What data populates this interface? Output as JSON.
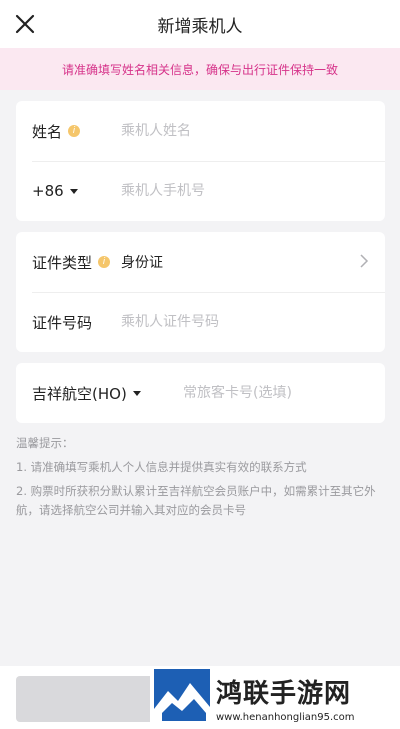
{
  "header": {
    "title": "新增乘机人",
    "close_icon": "close-icon"
  },
  "notice": {
    "text": "请准确填写姓名相关信息，确保与出行证件保持一致"
  },
  "name_card": {
    "name_label": "姓名",
    "name_placeholder": "乘机人姓名",
    "phone_prefix": "+86",
    "phone_placeholder": "乘机人手机号"
  },
  "id_card": {
    "type_label": "证件类型",
    "type_value": "身份证",
    "number_label": "证件号码",
    "number_placeholder": "乘机人证件号码"
  },
  "airline_card": {
    "airline_label": "吉祥航空(HO)",
    "member_placeholder": "常旅客卡号(选填)"
  },
  "tips": {
    "title": "温馨提示：",
    "items": [
      "1. 请准确填写乘机人个人信息并提供真实有效的联系方式",
      "2. 购票时所获积分默认累计至吉祥航空会员账户中，如需累计至其它外航，请选择航空公司并输入其对应的会员卡号"
    ]
  },
  "watermark": {
    "title": "鸿联手游网",
    "url": "www.henanhonglian95.com"
  },
  "colors": {
    "notice_text": "#d6338a",
    "notice_bg": "#fbe8f1",
    "info_icon": "#f5c66b"
  }
}
